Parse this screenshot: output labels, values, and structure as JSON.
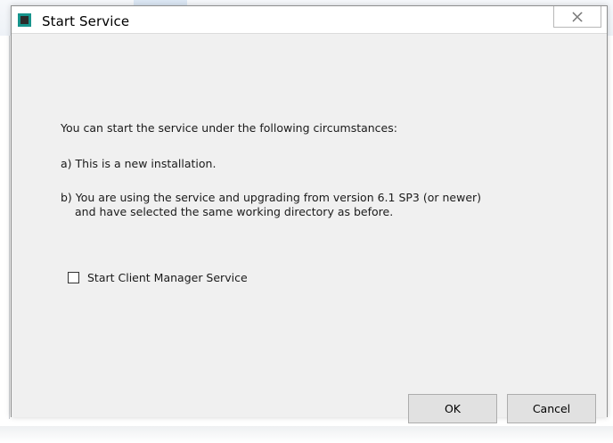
{
  "window": {
    "title": "Start Service",
    "icon": "app-square-icon"
  },
  "message": {
    "line1": "You can start the service under the following circumstances:",
    "line2": "a) This is a new installation.",
    "line3": "b) You are using the service and upgrading from version 6.1 SP3 (or newer)",
    "line3b": "and have selected the same working directory as before."
  },
  "option": {
    "label": "Start Client Manager Service",
    "checked": false
  },
  "buttons": {
    "ok": "OK",
    "cancel": "Cancel",
    "close_icon": "close-icon"
  },
  "colors": {
    "icon_border": "#17948c",
    "dialog_bg": "#f0f0f0",
    "button_bg": "#e1e1e1"
  }
}
